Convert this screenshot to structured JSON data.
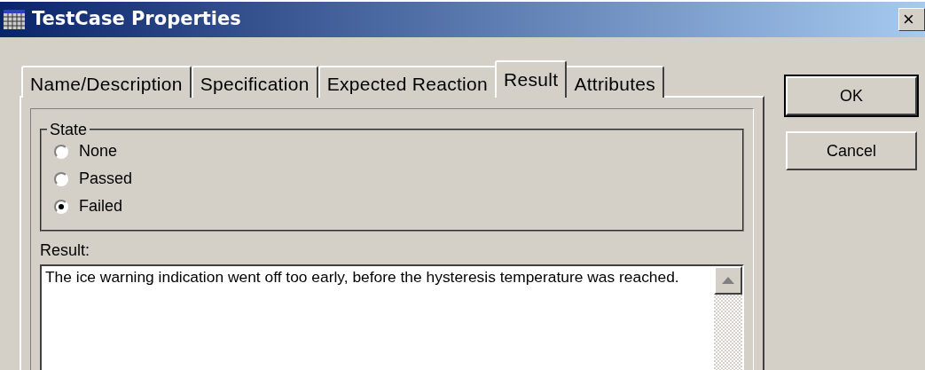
{
  "window": {
    "title": "TestCase Properties",
    "close": "×"
  },
  "tabs": [
    {
      "label": "Name/Description",
      "selected": false
    },
    {
      "label": "Specification",
      "selected": false
    },
    {
      "label": "Expected Reaction",
      "selected": false
    },
    {
      "label": "Result",
      "selected": true
    },
    {
      "label": "Attributes",
      "selected": false
    }
  ],
  "state_group": {
    "title": "State",
    "options": [
      {
        "label": "None",
        "selected": false
      },
      {
        "label": "Passed",
        "selected": false
      },
      {
        "label": "Failed",
        "selected": true
      }
    ]
  },
  "result": {
    "label": "Result:",
    "value": "The ice warning indication went off too early, before the hysteresis temperature was reached."
  },
  "buttons": [
    {
      "label": "OK",
      "default": true
    },
    {
      "label": "Cancel",
      "default": false
    }
  ]
}
